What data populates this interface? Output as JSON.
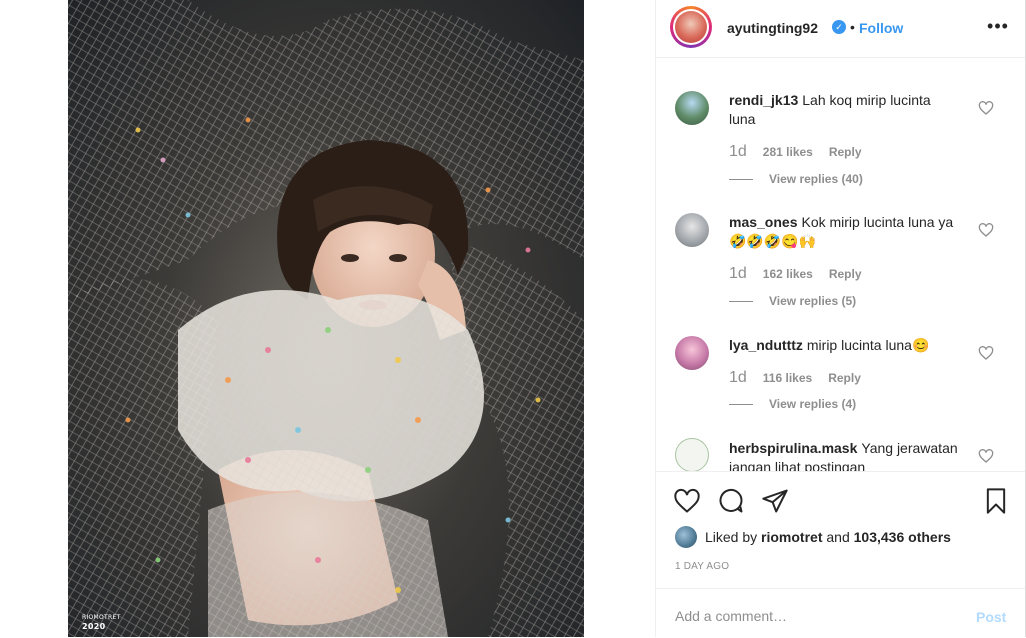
{
  "photo": {
    "watermark_line1": "RIOMOTRET",
    "watermark_line2": "2020"
  },
  "header": {
    "username": "ayutingting92",
    "separator": "•",
    "follow_label": "Follow",
    "more_label": "•••",
    "verified_icon": "✓"
  },
  "comments": [
    {
      "user": "rendi_jk13",
      "text": "Lah koq mirip lucinta luna",
      "age": "1d",
      "likes": "281 likes",
      "reply_label": "Reply",
      "view_replies": "View replies (40)"
    },
    {
      "user": "mas_ones",
      "text": "Kok mirip lucinta luna ya🤣🤣🤣😋🙌",
      "age": "1d",
      "likes": "162 likes",
      "reply_label": "Reply",
      "view_replies": "View replies (5)"
    },
    {
      "user": "lya_ndutttz",
      "text": "mirip lucinta luna😊",
      "age": "1d",
      "likes": "116 likes",
      "reply_label": "Reply",
      "view_replies": "View replies (4)"
    },
    {
      "user": "herbspirulina.mask",
      "text": "Yang jerawatan jangan lihat postingan",
      "age": "",
      "likes": "",
      "reply_label": "",
      "view_replies": ""
    }
  ],
  "likes_line": {
    "prefix": "Liked by",
    "liker": "riomotret",
    "connector": "and",
    "others": "103,436 others"
  },
  "timestamp": "1 DAY AGO",
  "add_comment": {
    "placeholder": "Add a comment…",
    "post_label": "Post"
  },
  "colors": {
    "accent": "#3897f0",
    "post_disabled": "#b3dbff",
    "muted": "#8e8e8e",
    "text": "#262626"
  },
  "icons": [
    "heart-icon",
    "comment-icon",
    "share-icon",
    "bookmark-icon",
    "more-icon",
    "verified-icon"
  ]
}
